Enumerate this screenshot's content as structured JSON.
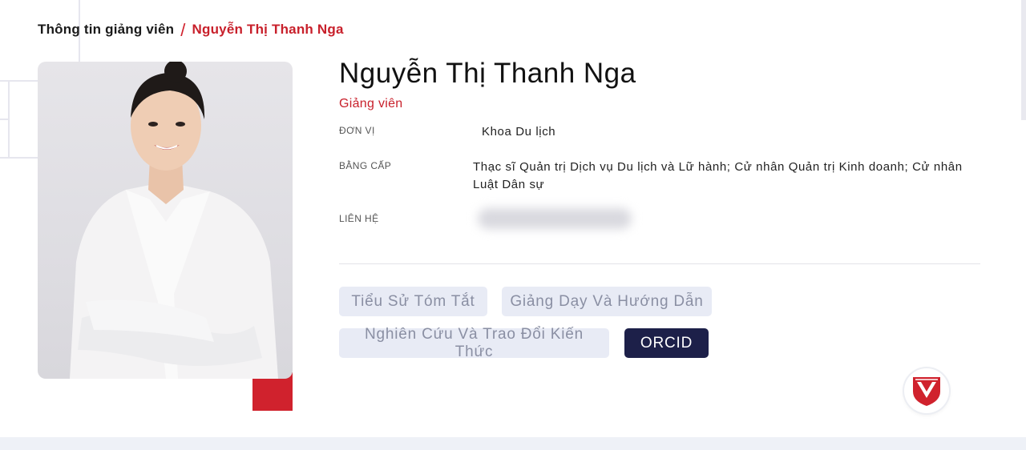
{
  "breadcrumb": {
    "home": "Thông tin giảng viên",
    "separator": "/",
    "current": "Nguyễn Thị Thanh Nga"
  },
  "profile": {
    "name": "Nguyễn Thị Thanh Nga",
    "role": "Giảng viên",
    "fields": {
      "unit_label": "ĐƠN VỊ",
      "unit_value": "Khoa Du lịch",
      "degree_label": "BẰNG CẤP",
      "degree_value": "Thạc sĩ Quản trị Dịch vụ Du lịch và Lữ hành; Cử nhân Quản trị Kinh doanh; Cử nhân Luật Dân sự",
      "contact_label": "LIÊN HỆ"
    }
  },
  "tabs": [
    {
      "label": "Tiểu Sử Tóm Tắt",
      "active": false
    },
    {
      "label": "Giảng Dạy Và Hướng Dẫn",
      "active": false
    },
    {
      "label": "Nghiên Cứu Và Trao Đổi Kiến Thức",
      "active": false
    },
    {
      "label": "ORCID",
      "active": true
    }
  ],
  "colors": {
    "accent_red": "#c8202b",
    "active_tab": "#1d2049",
    "inactive_tab": "#e8ebf5"
  },
  "icons": {
    "logo": "university-shield-logo-icon",
    "photo": "lecturer-portrait"
  }
}
